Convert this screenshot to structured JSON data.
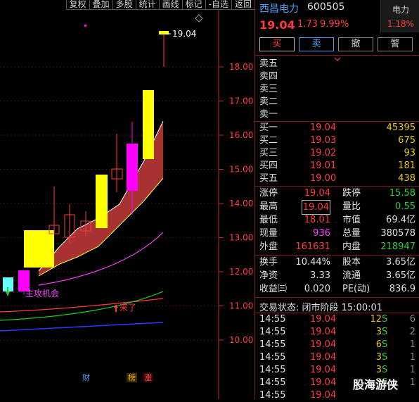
{
  "toolbar": {
    "items": [
      "复权",
      "叠加",
      "多股",
      "统计",
      "画线",
      "标记",
      "-自选",
      "返回"
    ]
  },
  "chart": {
    "price_labels": [
      "18.00",
      "17.00",
      "16.00",
      "15.00",
      "14.00",
      "13.00",
      "12.00",
      "11.00",
      "10.00"
    ],
    "high_label": "19.04",
    "annotation_1": "主攻机会",
    "annotation_2": "来了",
    "badges": [
      "财",
      "榜",
      "涨"
    ],
    "colors": {
      "up_fill": "#ffff00",
      "magenta": "#ff00ff",
      "cyan": "#66ffff",
      "ribbon": "#a83232",
      "axis": "#c8281e"
    }
  },
  "header": {
    "name": "西昌电力",
    "code": "600505",
    "price": "19.04",
    "change": "1.73",
    "change_pct": "9.99%",
    "sector_name": "电力",
    "sector_pct": "1.18%"
  },
  "buttons": {
    "buy": "买",
    "sell": "卖",
    "cancel": "撤",
    "alert": "警"
  },
  "order_book": {
    "asks": [
      {
        "label": "卖五",
        "price": "",
        "vol": ""
      },
      {
        "label": "卖四",
        "price": "",
        "vol": ""
      },
      {
        "label": "卖三",
        "price": "",
        "vol": ""
      },
      {
        "label": "卖二",
        "price": "",
        "vol": ""
      },
      {
        "label": "卖一",
        "price": "",
        "vol": ""
      }
    ],
    "bids": [
      {
        "label": "买一",
        "price": "19.04",
        "vol": "45395"
      },
      {
        "label": "买二",
        "price": "19.03",
        "vol": "675"
      },
      {
        "label": "买三",
        "price": "19.02",
        "vol": "93"
      },
      {
        "label": "买四",
        "price": "19.01",
        "vol": "181"
      },
      {
        "label": "买五",
        "price": "19.00",
        "vol": "438"
      }
    ]
  },
  "stats": {
    "limit_up_label": "涨停",
    "limit_up": "19.04",
    "limit_down_label": "跌停",
    "limit_down": "15.58",
    "high_label": "最高",
    "high": "19.04",
    "vol_ratio_label": "量比",
    "vol_ratio": "0.55",
    "low_label": "最低",
    "low": "18.01",
    "mkt_cap_label": "市值",
    "mkt_cap": "69.4亿",
    "last_vol_label": "现量",
    "last_vol": "936",
    "total_vol_label": "总量",
    "total_vol": "380578",
    "outer_label": "外盘",
    "outer": "161631",
    "inner_label": "内盘",
    "inner": "218947",
    "turnover_label": "换手",
    "turnover": "10.44%",
    "shares_label": "股本",
    "shares": "3.65亿",
    "nav_label": "净资",
    "nav": "3.33",
    "float_label": "流通",
    "float": "3.65亿",
    "eps_label": "收益㈢",
    "eps": "0.020",
    "pe_label": "PE(动)",
    "pe": "836.9"
  },
  "status": {
    "text": "交易状态: 闭市阶段 15:00:01"
  },
  "trades": [
    {
      "time": "14:55",
      "price": "19.04",
      "vol": "12",
      "side": "S",
      "num": "6"
    },
    {
      "time": "14:55",
      "price": "19.04",
      "vol": "3",
      "side": "S",
      "num": "2"
    },
    {
      "time": "14:55",
      "price": "19.04",
      "vol": "6",
      "side": "S",
      "num": "1"
    },
    {
      "time": "14:55",
      "price": "19.04",
      "vol": "3",
      "side": "S",
      "num": "1"
    },
    {
      "time": "14:55",
      "price": "19.04",
      "vol": "3",
      "side": "S",
      "num": "1"
    },
    {
      "time": "14:55",
      "price": "19.04",
      "vol": "3",
      "side": "S",
      "num": "1"
    },
    {
      "time": "14:55",
      "price": "19.04",
      "vol": "",
      "side": "",
      "num": ""
    }
  ],
  "watermark": "股海游侠"
}
